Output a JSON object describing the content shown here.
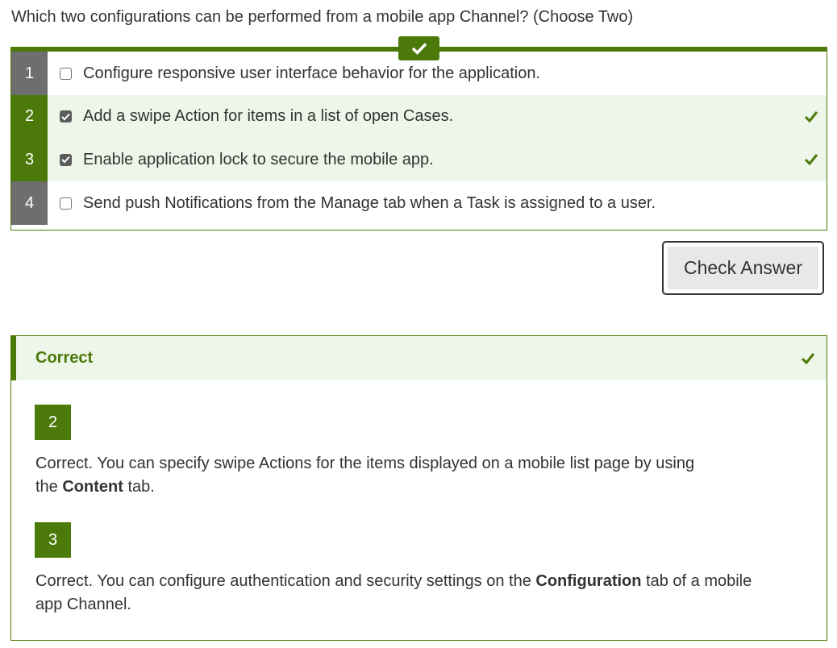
{
  "question": "Which two configurations can be performed from a mobile app Channel? (Choose Two)",
  "options": [
    {
      "num": "1",
      "text": "Configure responsive user interface behavior for the application.",
      "checked": false,
      "correct": false
    },
    {
      "num": "2",
      "text": "Add a swipe Action for items in a list of open Cases.",
      "checked": true,
      "correct": true
    },
    {
      "num": "3",
      "text": "Enable application lock to secure the mobile app.",
      "checked": true,
      "correct": true
    },
    {
      "num": "4",
      "text": "Send push Notifications from the Manage tab when a Task is assigned to a user.",
      "checked": false,
      "correct": false
    }
  ],
  "check_button_label": "Check Answer",
  "feedback": {
    "title": "Correct",
    "items": [
      {
        "num": "2",
        "line1": "Correct. You can specify swipe Actions for the items displayed on a mobile list page by using",
        "pre": "the ",
        "bold": "Content",
        "post": " tab."
      },
      {
        "num": "3",
        "pre": "Correct. You can configure authentication and security settings on the ",
        "bold": "Configuration",
        "post": " tab of a mobile",
        "line2": "app Channel."
      }
    ]
  },
  "colors": {
    "accent": "#4c7a0a",
    "correct_bg": "#edf6e8",
    "number_gray": "#6e6e6e"
  },
  "icons": {
    "badge": "check-icon",
    "row_mark": "check-icon",
    "feedback_mark": "check-icon"
  }
}
